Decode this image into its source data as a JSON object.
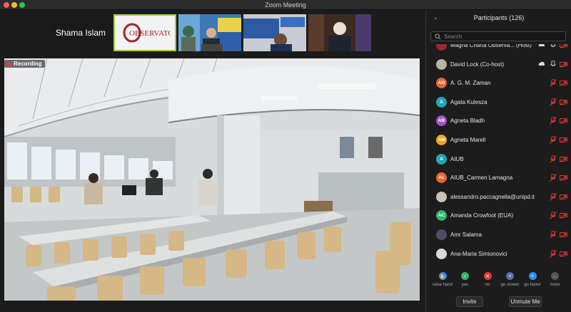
{
  "window": {
    "title": "Zoom Meeting"
  },
  "gallery": {
    "current_speaker": "Shama Islam",
    "logo_text": "OBSERVATORY",
    "next_label": "›"
  },
  "recording": {
    "label": "Recording"
  },
  "participants": {
    "header": "Participants (126)",
    "search_placeholder": "Search",
    "list": [
      {
        "name": "Magna Charta Observa... (Host)",
        "initials": "",
        "color": "#9c2a2a",
        "photo": true,
        "muted": false
      },
      {
        "name": "David Lock (Co-host)",
        "initials": "",
        "color": "#b9b2a6",
        "photo": true,
        "muted": false
      },
      {
        "name": "A. G. M. Zaman",
        "initials": "AG",
        "color": "#e8642c",
        "photo": false,
        "muted": true
      },
      {
        "name": "Agata Kulesza",
        "initials": "A",
        "color": "#22a7b8",
        "photo": false,
        "muted": true
      },
      {
        "name": "Agneta Bladh",
        "initials": "AB",
        "color": "#a94fc9",
        "photo": false,
        "muted": true
      },
      {
        "name": "Agneta Marell",
        "initials": "AM",
        "color": "#f0a31c",
        "photo": false,
        "muted": true
      },
      {
        "name": "AIUB",
        "initials": "A",
        "color": "#22a7b8",
        "photo": false,
        "muted": true
      },
      {
        "name": "AIUB_Carmen Lamagna",
        "initials": "AL",
        "color": "#e8642c",
        "photo": false,
        "muted": true
      },
      {
        "name": "alessandro.paccagnella@unipd.it",
        "initials": "",
        "color": "#c9c2b5",
        "photo": true,
        "muted": true
      },
      {
        "name": "Amanda Crowfoot (EUA)",
        "initials": "AC",
        "color": "#2fb56a",
        "photo": false,
        "muted": true
      },
      {
        "name": "Amr Salama",
        "initials": "",
        "color": "#4a4f66",
        "photo": true,
        "muted": true
      },
      {
        "name": "Ana-Maria Simionovici",
        "initials": "",
        "color": "#d9d9d9",
        "photo": true,
        "muted": true
      }
    ]
  },
  "reactions": [
    {
      "label": "raise hand",
      "color": "#2d8cff",
      "symbol": "✋"
    },
    {
      "label": "yes",
      "color": "#2fb56a",
      "symbol": "✓"
    },
    {
      "label": "no",
      "color": "#e53935",
      "symbol": "✕"
    },
    {
      "label": "go slower",
      "color": "#5a6aa8",
      "symbol": "«"
    },
    {
      "label": "go faster",
      "color": "#2d8cff",
      "symbol": "»"
    },
    {
      "label": "more",
      "color": "#555555",
      "symbol": "…"
    }
  ],
  "buttons": {
    "invite": "Invite",
    "unmute_me": "Unmute Me"
  }
}
